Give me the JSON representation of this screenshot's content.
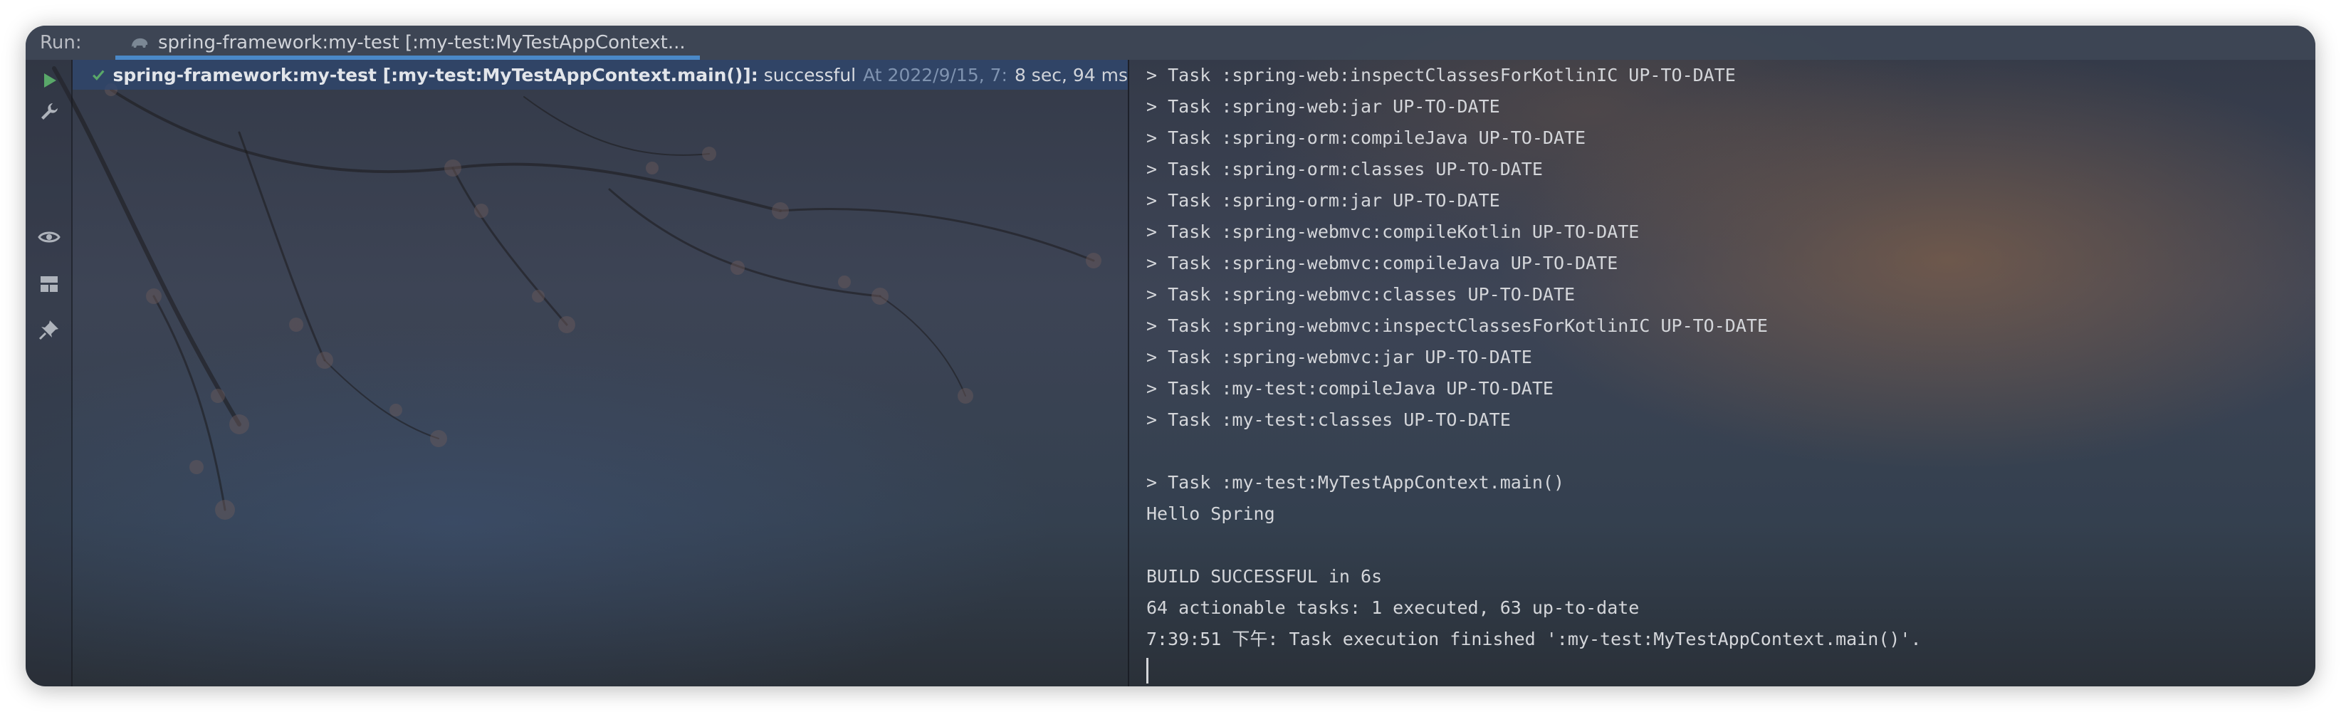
{
  "run_panel": {
    "label": "Run:",
    "tab": {
      "icon": "gradle-elephant-icon",
      "title": "spring-framework:my-test [:my-test:MyTestAppContext..."
    }
  },
  "toolbar": {
    "items": [
      {
        "name": "rerun-icon"
      },
      {
        "name": "wrench-icon"
      },
      {
        "name": "eye-icon"
      },
      {
        "name": "layout-icon"
      },
      {
        "name": "pin-icon"
      }
    ]
  },
  "tree": {
    "status_icon": "check-icon",
    "name": "spring-framework:my-test [:my-test:MyTestAppContext.main()]:",
    "status": "successful",
    "time": "At 2022/9/15, 7:",
    "duration": "8 sec, 94 ms"
  },
  "console": {
    "lines": [
      "> Task :spring-web:inspectClassesForKotlinIC UP-TO-DATE",
      "> Task :spring-web:jar UP-TO-DATE",
      "> Task :spring-orm:compileJava UP-TO-DATE",
      "> Task :spring-orm:classes UP-TO-DATE",
      "> Task :spring-orm:jar UP-TO-DATE",
      "> Task :spring-webmvc:compileKotlin UP-TO-DATE",
      "> Task :spring-webmvc:compileJava UP-TO-DATE",
      "> Task :spring-webmvc:classes UP-TO-DATE",
      "> Task :spring-webmvc:inspectClassesForKotlinIC UP-TO-DATE",
      "> Task :spring-webmvc:jar UP-TO-DATE",
      "> Task :my-test:compileJava UP-TO-DATE",
      "> Task :my-test:classes UP-TO-DATE",
      "",
      "> Task :my-test:MyTestAppContext.main()",
      "Hello Spring",
      "",
      "BUILD SUCCESSFUL in 6s",
      "64 actionable tasks: 1 executed, 63 up-to-date",
      "7:39:51 下午: Task execution finished ':my-test:MyTestAppContext.main()'."
    ]
  },
  "colors": {
    "accent": "#4a88c7",
    "success": "#59a869",
    "selection": "#2f466e"
  }
}
